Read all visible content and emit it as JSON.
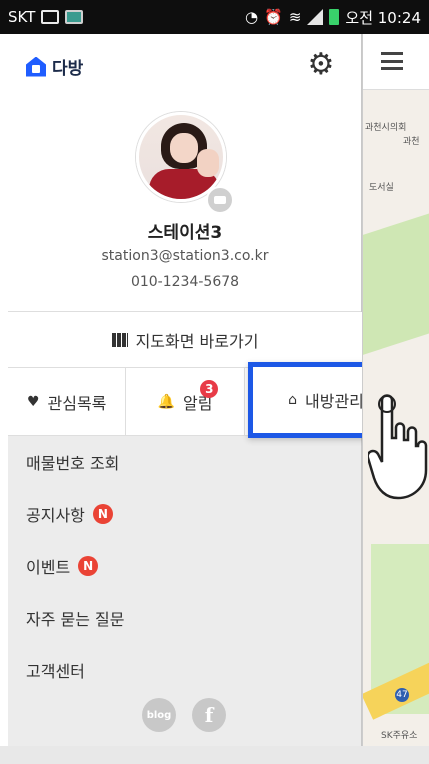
{
  "status_bar": {
    "carrier": "SKT",
    "time": "오전 10:24"
  },
  "drawer": {
    "logo_text": "다방",
    "profile": {
      "name": "스테이션3",
      "email": "station3@station3.co.kr",
      "phone": "010-1234-5678"
    },
    "map_shortcut": "지도화면 바로가기",
    "tabs": [
      {
        "label": "관심목록"
      },
      {
        "label": "알림",
        "badge": "3"
      },
      {
        "label": "내방관리"
      }
    ],
    "menu_items": [
      {
        "label": "매물번호 조회"
      },
      {
        "label": "공지사항",
        "badge": "N"
      },
      {
        "label": "이벤트",
        "badge": "N"
      },
      {
        "label": "자주 묻는 질문"
      },
      {
        "label": "고객센터"
      }
    ],
    "social": {
      "blog": "blog",
      "facebook": "f"
    }
  },
  "map": {
    "labels": [
      "과천시의회",
      "과천",
      "도서실",
      "SK주유소",
      "47"
    ]
  },
  "colors": {
    "brand_blue": "#1f5dff",
    "highlight_blue": "#1d58e6",
    "badge_red": "#e83b47"
  }
}
